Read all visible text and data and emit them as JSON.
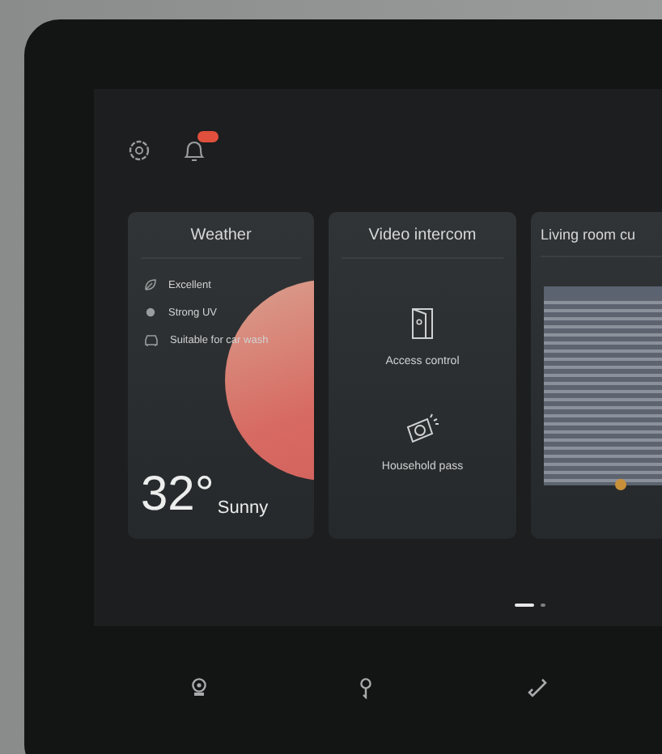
{
  "status_icons": {
    "notification_badge": true
  },
  "cards": [
    {
      "kind": "weather",
      "title": "Weather",
      "items": [
        {
          "label": "Excellent"
        },
        {
          "label": "Strong UV"
        },
        {
          "label": "Suitable for car wash"
        }
      ],
      "temperature": "32°",
      "condition": "Sunny"
    },
    {
      "kind": "intercom",
      "title": "Video intercom",
      "actions": [
        {
          "label": "Access control"
        },
        {
          "label": "Household pass"
        }
      ]
    },
    {
      "kind": "curtain",
      "title": "Living room cu"
    }
  ],
  "pages": [
    {
      "selected": true
    },
    {
      "selected": false
    }
  ]
}
